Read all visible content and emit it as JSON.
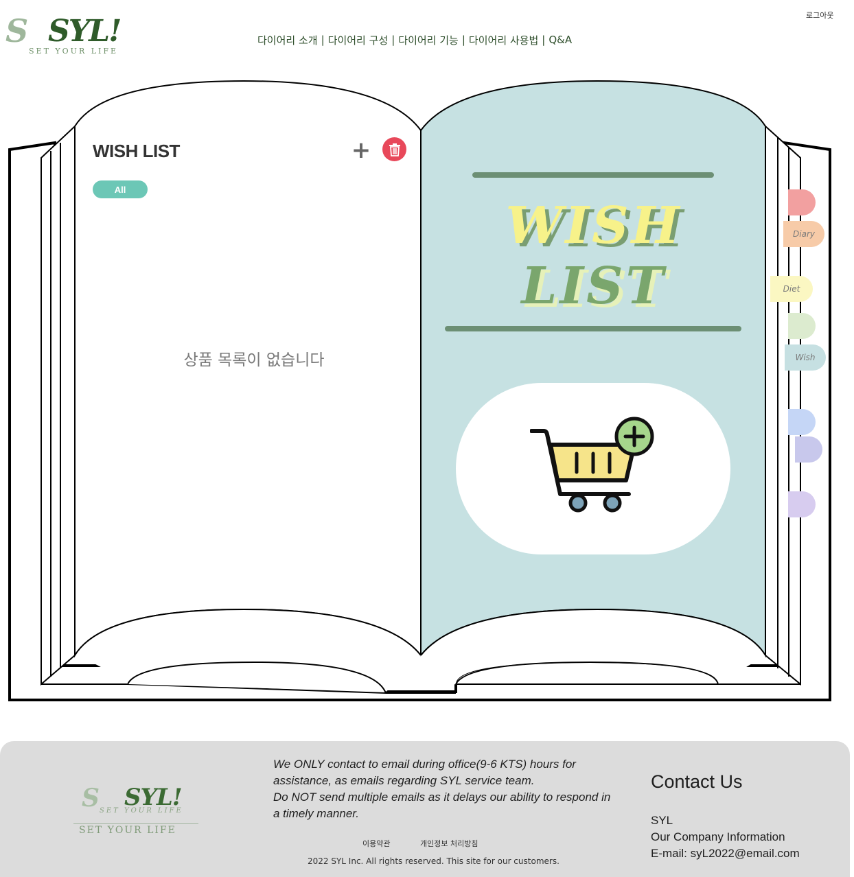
{
  "header": {
    "logo_text": "SYL!",
    "logo_script": "S",
    "logo_tagline": "SET YOUR LIFE",
    "nav": [
      "다이어리 소개",
      "다이어리 구성",
      "다이어리 기능",
      "다이어리 사용법",
      "Q&A"
    ],
    "nav_separator": "|",
    "logout": "로그아웃"
  },
  "left_page": {
    "title": "WISH LIST",
    "add_label": "+",
    "filter_all": "All",
    "empty_message": "상품 목록이 없습니다"
  },
  "right_page": {
    "art_line1": "WISH",
    "art_line2": "LIST",
    "cart_icon": "cart-plus-icon"
  },
  "tabs": [
    {
      "label": "",
      "color": "#f2a0a0"
    },
    {
      "label": "Diary",
      "color": "#f7cba8"
    },
    {
      "label": "Diet",
      "color": "#fbf7c2"
    },
    {
      "label": "",
      "color": "#dcebcf"
    },
    {
      "label": "Wish",
      "color": "#c6e0e2"
    },
    {
      "label": "",
      "color": "#c5d6f6"
    },
    {
      "label": "",
      "color": "#c8c8ec"
    },
    {
      "label": "",
      "color": "#d7ccef"
    }
  ],
  "colors": {
    "page_bg_right": "#c6e1e2",
    "accent_green": "#6c8f74",
    "delete_red": "#e8485a",
    "pill_teal": "#6cc7b6"
  },
  "footer": {
    "logo_text": "SYL!",
    "logo_script": "S",
    "logo_tagline": "SET YOUR LIFE",
    "logo_tagline2": "SET YOUR LIFE",
    "notice_1": "We ONLY contact to email during office(9-6 KTS) hours for assistance, as emails regarding SYL service team.",
    "notice_2": "Do NOT send multiple emails as it delays our ability to respond in a timely manner.",
    "link_terms": "이용약관",
    "link_privacy": "개인정보 처리방침",
    "copyright": "2022 SYL Inc. All rights reserved. This site for our customers.",
    "contact_title": "Contact Us",
    "contact_company": "SYL",
    "contact_info": "Our Company Information",
    "contact_email": "E-mail: syL2022@email.com"
  }
}
